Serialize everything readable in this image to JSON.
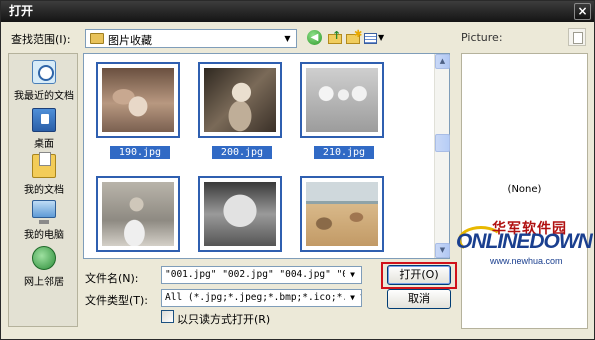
{
  "window": {
    "title": "打开",
    "close_glyph": "×"
  },
  "toolbar": {
    "lookin_label": "查找范围(I):",
    "lookin_value": "图片收藏",
    "icons": [
      "back-icon",
      "up-folder-icon",
      "new-folder-icon",
      "views-menu-icon"
    ]
  },
  "places": [
    {
      "label": "我最近的文档",
      "icon": "recent-documents-icon"
    },
    {
      "label": "桌面",
      "icon": "desktop-icon"
    },
    {
      "label": "我的文档",
      "icon": "my-documents-icon"
    },
    {
      "label": "我的电脑",
      "icon": "my-computer-icon"
    },
    {
      "label": "网上邻居",
      "icon": "network-icon"
    }
  ],
  "files": [
    {
      "name": "190.jpg",
      "selected": true
    },
    {
      "name": "200.jpg",
      "selected": true
    },
    {
      "name": "210.jpg",
      "selected": true
    },
    {
      "name": "",
      "selected": true
    },
    {
      "name": "",
      "selected": true
    },
    {
      "name": "",
      "selected": false
    }
  ],
  "scrollbar": {
    "up": "▲",
    "down": "▼"
  },
  "form": {
    "filename_label": "文件名(N):",
    "filename_value": "\"001.jpg\" \"002.jpg\" \"004.jpg\" \"005.jp",
    "filetype_label": "文件类型(T):",
    "filetype_value": "All (*.jpg;*.jpeg;*.bmp;*.ico;*.emf;*",
    "readonly_label": "以只读方式打开(R)",
    "open_button": "打开(O)",
    "cancel_button": "取消",
    "dropdown_glyph": "▼"
  },
  "preview": {
    "label": "Picture:",
    "none_text": "(None)",
    "watermark_cn": "华军软件园",
    "watermark_logo": "ONLINEDOWN",
    "watermark_url": "www.newhua.com"
  },
  "colors": {
    "highlight": "#d0121a",
    "selection": "#316ac5",
    "titlebar": "#1f1f1f"
  }
}
